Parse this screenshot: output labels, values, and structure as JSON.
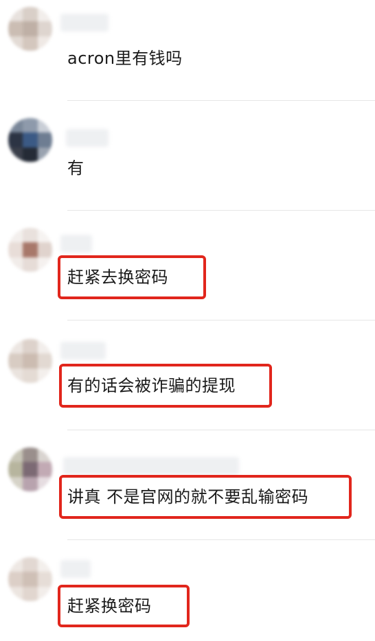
{
  "comments": [
    {
      "text": "acron里有钱吗",
      "highlighted": false
    },
    {
      "text": "有",
      "highlighted": false
    },
    {
      "text": "赶紧去换密码",
      "highlighted": true
    },
    {
      "text": "有的话会被诈骗的提现",
      "highlighted": true
    },
    {
      "text": "讲真 不是官网的就不要乱输密码",
      "highlighted": true
    },
    {
      "text": "赶紧换密码",
      "highlighted": true
    }
  ],
  "colors": {
    "highlight_border": "#e1261c",
    "text": "#1a1a1a",
    "divider": "#e6e6e6"
  }
}
